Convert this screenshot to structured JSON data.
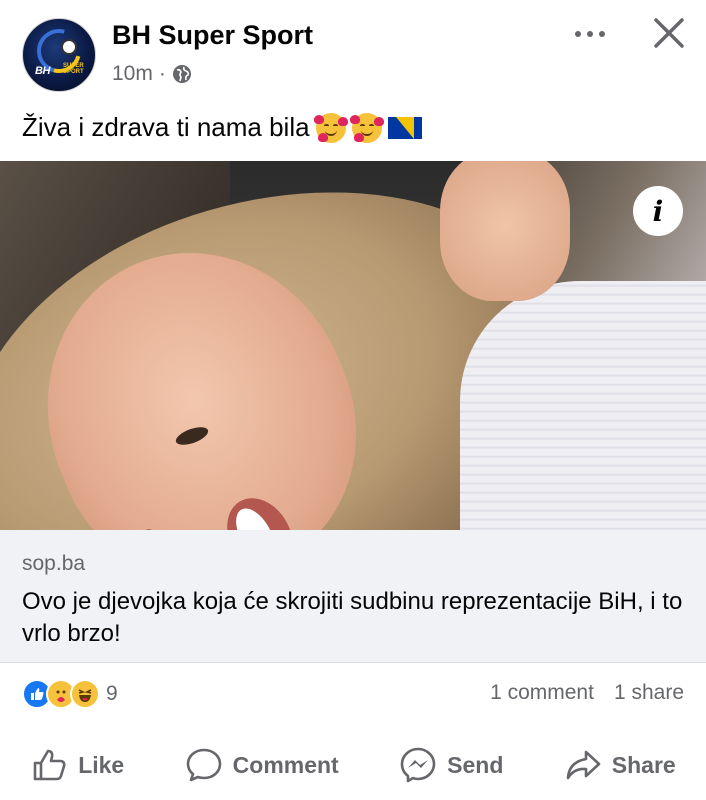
{
  "post": {
    "page_name": "BH Super Sport",
    "time": "10m",
    "separator": "·",
    "caption": "Živa i zdrava ti nama bila",
    "caption_emojis": [
      "smiling-face-with-hearts",
      "smiling-face-with-hearts",
      "flag-bosnia-herzegovina"
    ],
    "avatar_logo": {
      "text": "BH",
      "subtext": "SUPER SPORT"
    }
  },
  "link": {
    "domain": "sop.ba",
    "title": "Ovo je djevojka koja će skrojiti sudbinu reprezentacije BiH, i to vrlo brzo!"
  },
  "engagement": {
    "reactions": [
      "like",
      "care",
      "haha"
    ],
    "reaction_count": "9",
    "comments": "1 comment",
    "shares": "1 share"
  },
  "actions": {
    "like": "Like",
    "comment": "Comment",
    "send": "Send",
    "share": "Share"
  },
  "icons": {
    "globe": "globe-icon",
    "more": "more-icon",
    "close": "close-icon",
    "info": "info-icon"
  },
  "colors": {
    "text_primary": "#050505",
    "text_secondary": "#65676b",
    "link_bg": "#f0f2f5",
    "like_blue": "#1877f2",
    "reaction_yellow": "#f7c23b"
  }
}
